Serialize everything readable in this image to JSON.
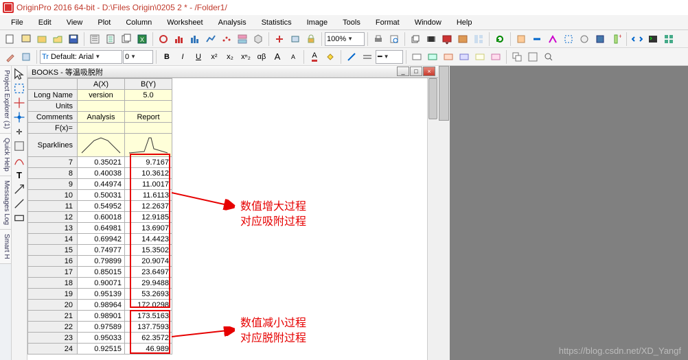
{
  "title": "OriginPro 2016 64-bit - D:\\Files Origin\\0205 2 * - /Folder1/",
  "menu": {
    "items": [
      "File",
      "Edit",
      "View",
      "Plot",
      "Column",
      "Worksheet",
      "Analysis",
      "Statistics",
      "Image",
      "Tools",
      "Format",
      "Window",
      "Help"
    ]
  },
  "format_toolbar": {
    "font_selector_prefix": "Tr",
    "font": "Default: Arial",
    "size": "0",
    "bold": "B",
    "italic": "I",
    "underline": "U"
  },
  "zoom": "100%",
  "sidebar_tabs": [
    "Project Explorer (1)",
    "Quick Help",
    "Messages Log",
    "Smart H"
  ],
  "doc": {
    "title": "BOOKS - 等温吸脱附"
  },
  "columns": {
    "row_hdr_blank": "",
    "A": "A(X)",
    "B": "B(Y)"
  },
  "meta_rows": {
    "LongName": {
      "label": "Long Name",
      "A": "version",
      "B": "5.0"
    },
    "Units": {
      "label": "Units",
      "A": "",
      "B": ""
    },
    "Comments": {
      "label": "Comments",
      "A": "Analysis",
      "B": "Report"
    },
    "Fx": {
      "label": "F(x)=",
      "A": "",
      "B": ""
    },
    "Sparklines": {
      "label": "Sparklines"
    }
  },
  "rows": [
    {
      "n": "7",
      "A": "0.35021",
      "B": "9.7167"
    },
    {
      "n": "8",
      "A": "0.40038",
      "B": "10.3612"
    },
    {
      "n": "9",
      "A": "0.44974",
      "B": "11.0017"
    },
    {
      "n": "10",
      "A": "0.50031",
      "B": "11.6113"
    },
    {
      "n": "11",
      "A": "0.54952",
      "B": "12.2637"
    },
    {
      "n": "12",
      "A": "0.60018",
      "B": "12.9185"
    },
    {
      "n": "13",
      "A": "0.64981",
      "B": "13.6907"
    },
    {
      "n": "14",
      "A": "0.69942",
      "B": "14.4423"
    },
    {
      "n": "15",
      "A": "0.74977",
      "B": "15.3502"
    },
    {
      "n": "16",
      "A": "0.79899",
      "B": "20.9074"
    },
    {
      "n": "17",
      "A": "0.85015",
      "B": "23.6497"
    },
    {
      "n": "18",
      "A": "0.90071",
      "B": "29.9488"
    },
    {
      "n": "19",
      "A": "0.95139",
      "B": "53.2693"
    },
    {
      "n": "20",
      "A": "0.98964",
      "B": "172.0298"
    },
    {
      "n": "21",
      "A": "0.98901",
      "B": "173.5163"
    },
    {
      "n": "22",
      "A": "0.97589",
      "B": "137.7593"
    },
    {
      "n": "23",
      "A": "0.95033",
      "B": "62.3572"
    },
    {
      "n": "24",
      "A": "0.92515",
      "B": "46.989"
    }
  ],
  "annotations": {
    "increase": {
      "line1": "数值增大过程",
      "line2": "对应吸附过程"
    },
    "decrease": {
      "line1": "数值减小过程",
      "line2": "对应脱附过程"
    }
  },
  "watermark": "https://blog.csdn.net/XD_Yangf"
}
